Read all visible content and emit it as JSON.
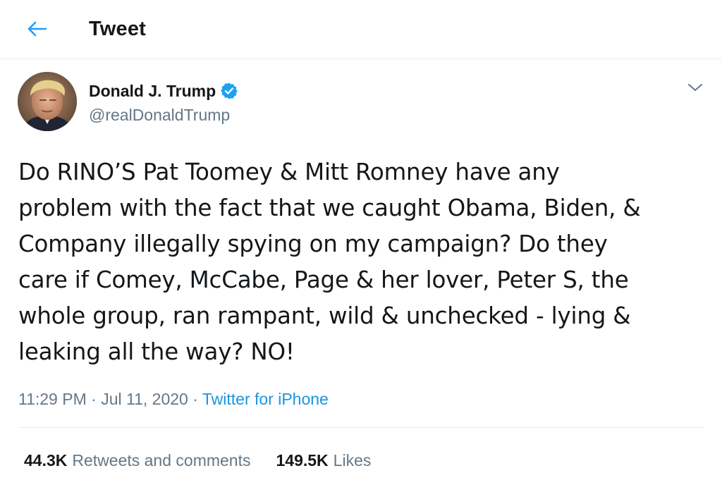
{
  "header": {
    "back_icon": "arrow-left-icon",
    "title": "Tweet"
  },
  "colors": {
    "accent": "#1da1f2",
    "link": "#1b95e0",
    "secondary_text": "#657786",
    "primary_text": "#14171a",
    "divider": "#e6ecf0"
  },
  "author": {
    "name": "Donald J. Trump",
    "handle": "@realDonaldTrump",
    "verified_icon": "verified-badge-icon",
    "avatar": "profile-photo"
  },
  "menu": {
    "icon": "chevron-down-icon"
  },
  "tweet": {
    "lines": [
      "Do RINO’S Pat Toomey & Mitt Romney have any",
      "problem with the fact that we caught Obama, Biden, &",
      "Company illegally spying on my campaign? Do they",
      "care if Comey, McCabe, Page & her lover, Peter S, the",
      "whole group, ran rampant, wild & unchecked - lying &",
      "leaking all the way? NO!"
    ],
    "time": "11:29 PM",
    "separator": "·",
    "date": "Jul 11, 2020",
    "source": "Twitter for iPhone"
  },
  "stats": {
    "retweets_count": "44.3K",
    "retweets_label": "Retweets and comments",
    "likes_count": "149.5K",
    "likes_label": "Likes"
  }
}
